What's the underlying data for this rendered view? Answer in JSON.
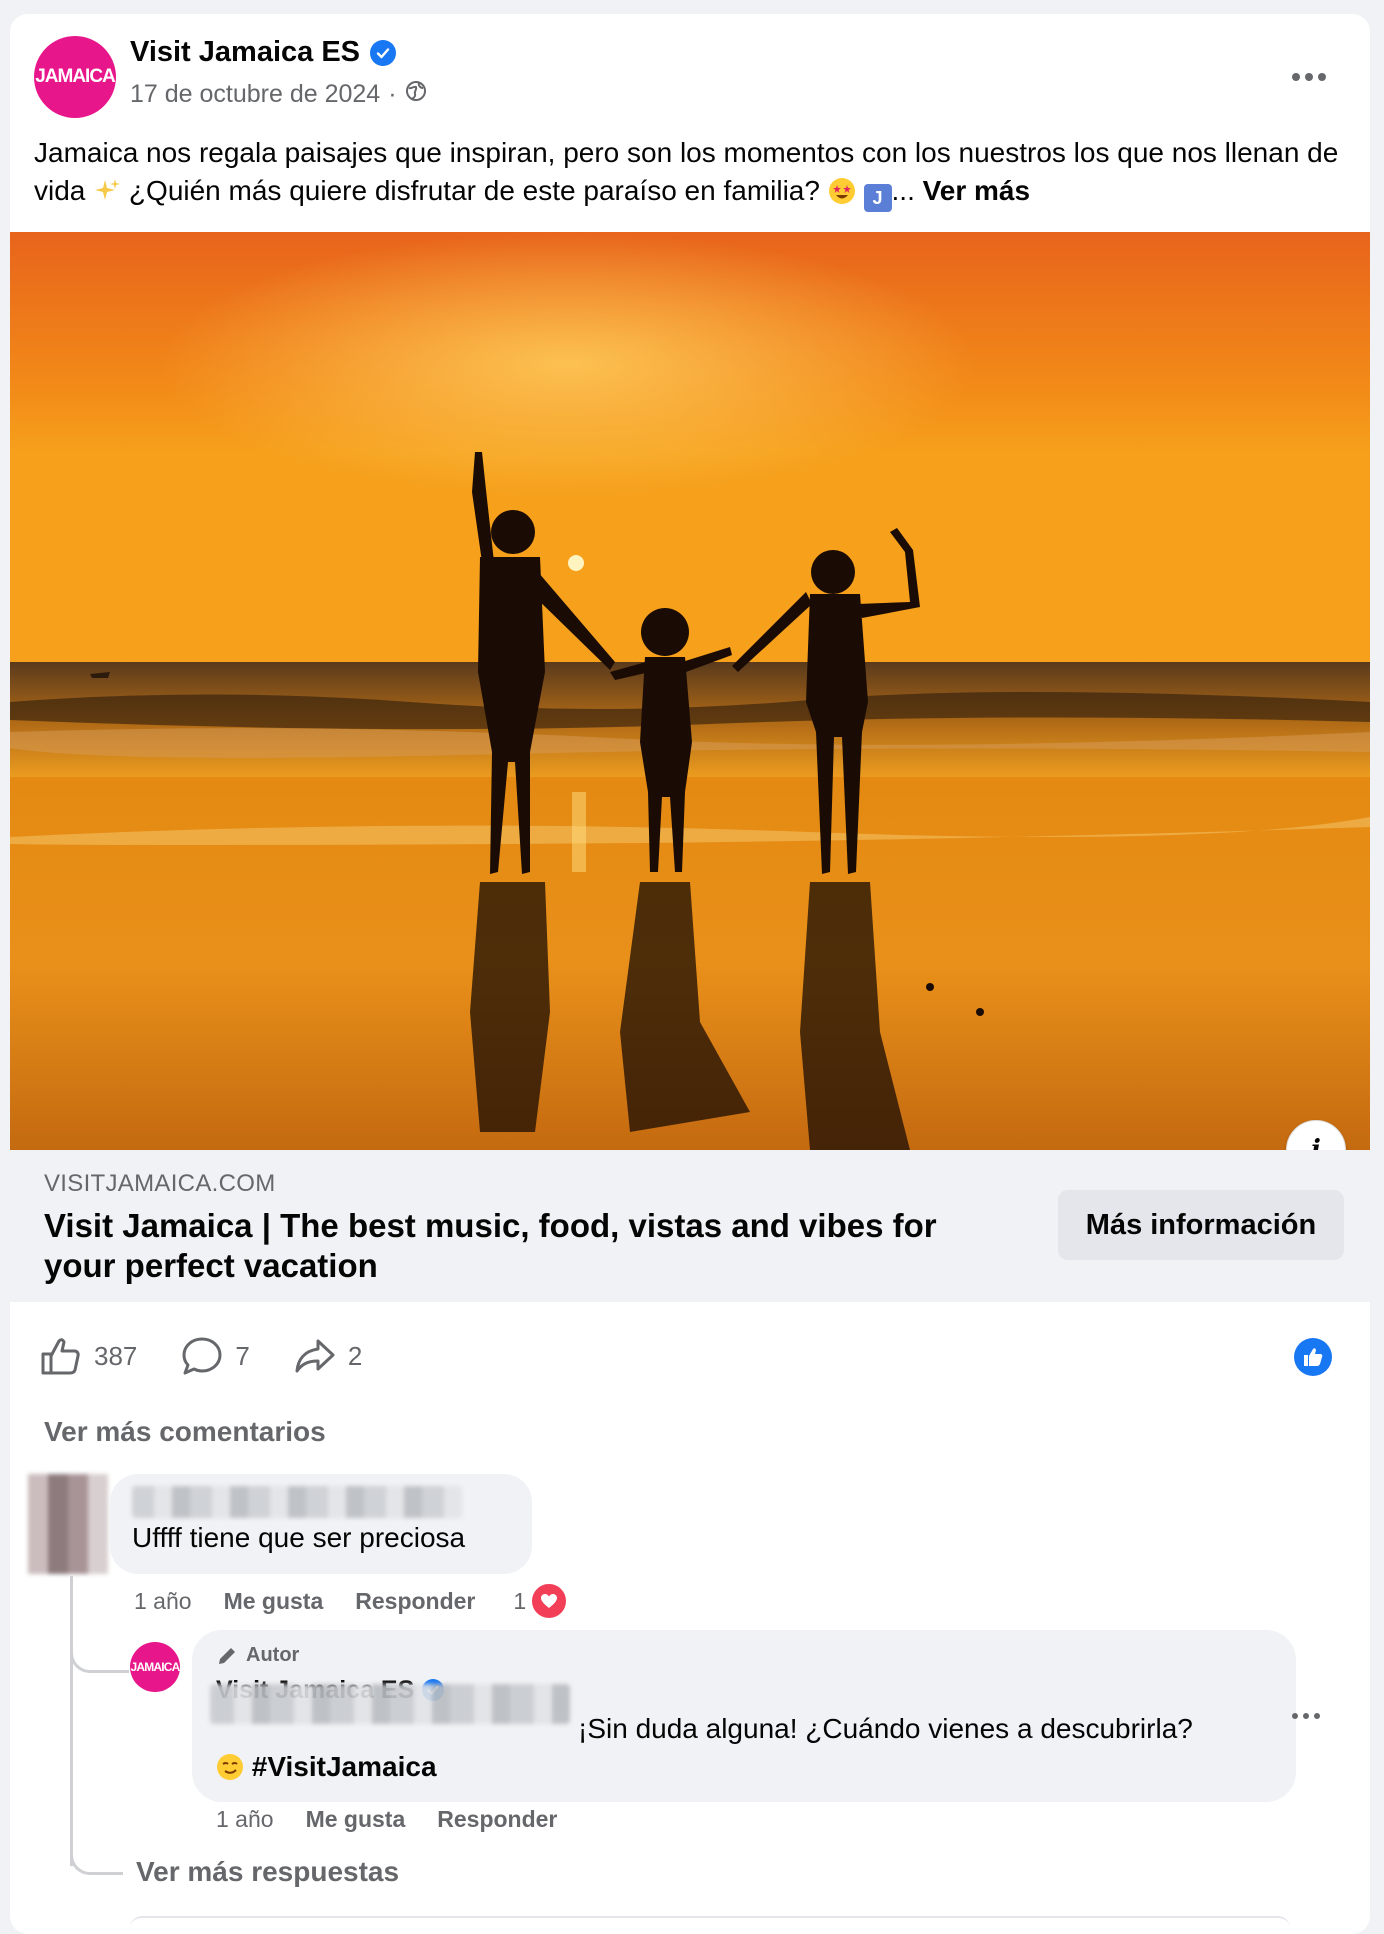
{
  "post": {
    "page_name": "Visit Jamaica ES",
    "avatar_text": "JAMAICA",
    "date": "17 de octubre de 2024",
    "separator": "·",
    "caption_part1": "Jamaica nos regala paisajes que inspiran, pero son los momentos con los nuestros los que nos llenan de vida ",
    "caption_part2": " ¿Quién más quiere disfrutar de este paraíso en familia? ",
    "emoji_j": "J",
    "ellipsis": "...",
    "see_more": "Ver más"
  },
  "link_preview": {
    "domain": "VISITJAMAICA.COM",
    "title": "Visit Jamaica | The best music, food, vistas and vibes for your perfect vacation",
    "cta": "Más información"
  },
  "stats": {
    "likes": "387",
    "comments": "7",
    "shares": "2"
  },
  "comments": {
    "view_more": "Ver más comentarios",
    "first": {
      "text": "Uffff tiene que ser preciosa",
      "age": "1 año",
      "like": "Me gusta",
      "reply": "Responder",
      "reaction_count": "1"
    },
    "reply": {
      "badge": "Autor",
      "author": "Visit Jamaica ES",
      "avatar_text": "JAMAICA",
      "text": "¡Sin duda alguna! ¿Cuándo vienes a descubrirla?",
      "hashtag": "#VisitJamaica",
      "age": "1 año",
      "like": "Me gusta",
      "reply": "Responder"
    },
    "view_more_replies": "Ver más respuestas"
  },
  "colors": {
    "brand_pink": "#e8168b",
    "facebook_blue": "#1877f2",
    "muted_text": "#65676b",
    "bubble_bg": "#f0f2f5"
  }
}
